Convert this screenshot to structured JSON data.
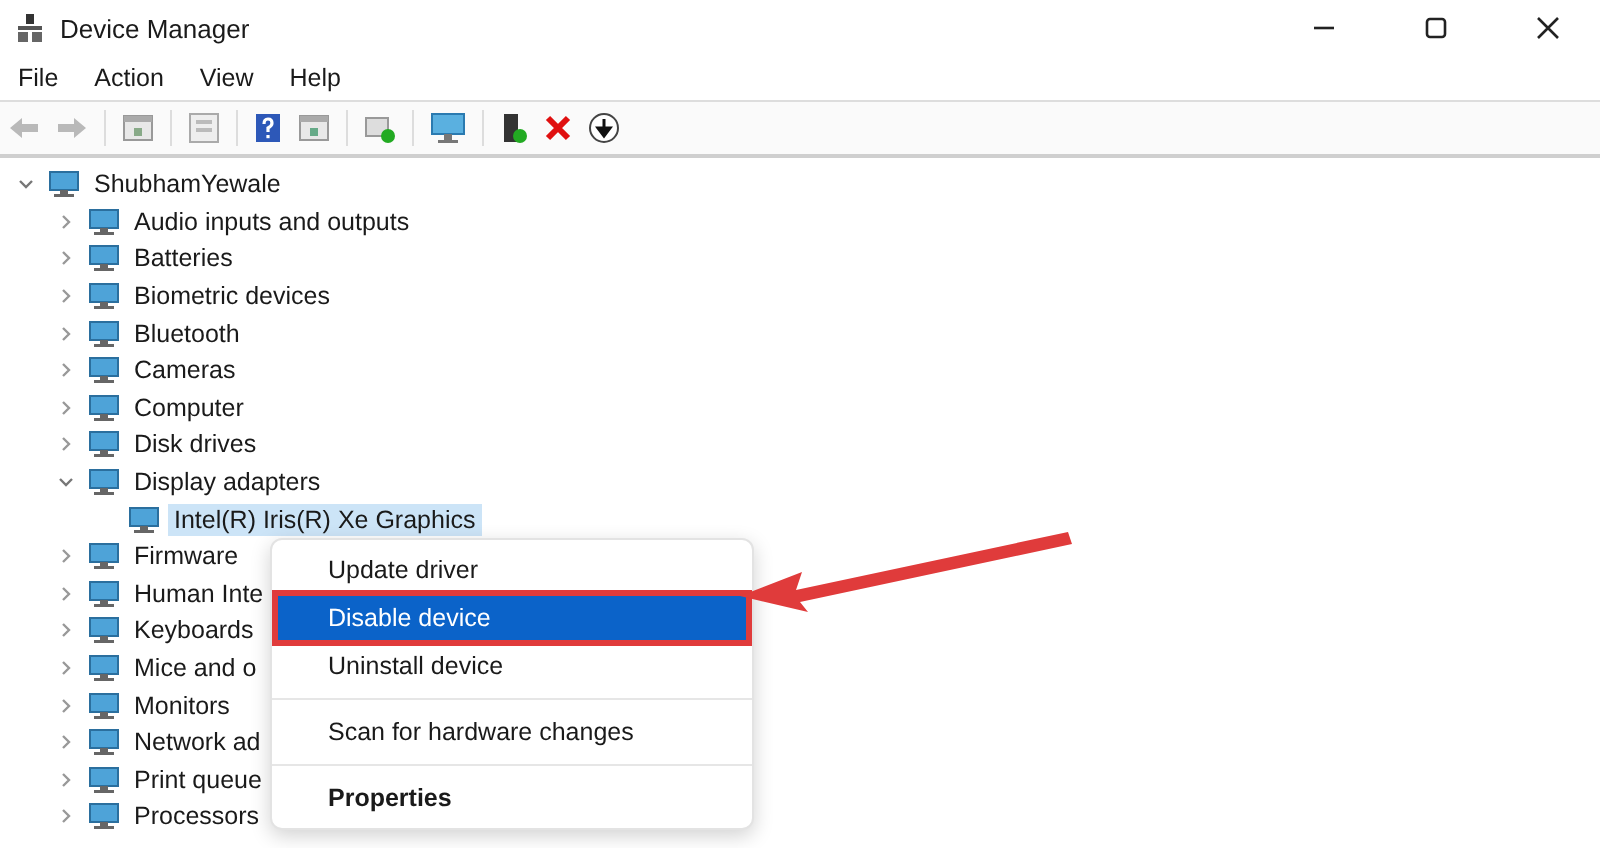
{
  "window": {
    "title": "Device Manager"
  },
  "menu_bar": [
    "File",
    "Action",
    "View",
    "Help"
  ],
  "tree": {
    "label": "ShubhamYewale",
    "expanded": true,
    "children": [
      {
        "label": "Audio inputs and outputs",
        "expanded": false
      },
      {
        "label": "Batteries",
        "expanded": false
      },
      {
        "label": "Biometric devices",
        "expanded": false
      },
      {
        "label": "Bluetooth",
        "expanded": false
      },
      {
        "label": "Cameras",
        "expanded": false
      },
      {
        "label": "Computer",
        "expanded": false
      },
      {
        "label": "Disk drives",
        "expanded": false
      },
      {
        "label": "Display adapters",
        "expanded": true,
        "children": [
          {
            "label": "Intel(R) Iris(R) Xe Graphics",
            "selected": true
          }
        ]
      },
      {
        "label": "Firmware",
        "expanded": false
      },
      {
        "label": "Human Inte",
        "expanded": false
      },
      {
        "label": "Keyboards",
        "expanded": false
      },
      {
        "label": "Mice and o",
        "expanded": false
      },
      {
        "label": "Monitors",
        "expanded": false
      },
      {
        "label": "Network ad",
        "expanded": false
      },
      {
        "label": "Print queue",
        "expanded": false
      },
      {
        "label": "Processors",
        "expanded": false
      }
    ]
  },
  "context_menu": {
    "items": [
      {
        "kind": "item",
        "label": "Update driver",
        "selected": false
      },
      {
        "kind": "item",
        "label": "Disable device",
        "selected": true
      },
      {
        "kind": "item",
        "label": "Uninstall device",
        "selected": false
      },
      {
        "kind": "separator"
      },
      {
        "kind": "item",
        "label": "Scan for hardware changes",
        "selected": false
      },
      {
        "kind": "separator"
      },
      {
        "kind": "default",
        "label": "Properties",
        "selected": false
      }
    ]
  }
}
